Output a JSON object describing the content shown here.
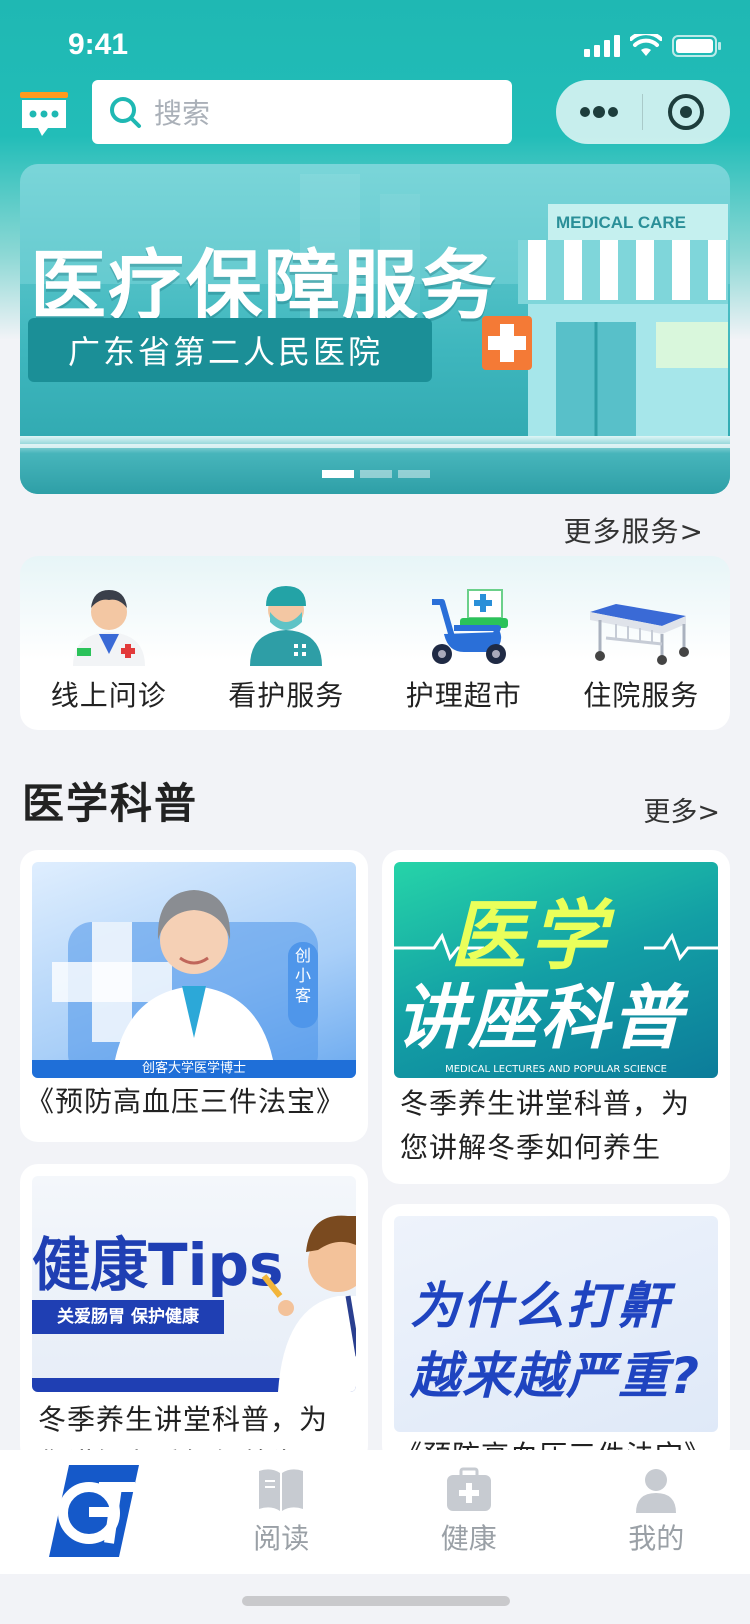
{
  "status": {
    "time": "9:41"
  },
  "header": {
    "search_placeholder": "搜索"
  },
  "banner": {
    "title": "医疗保障服务",
    "subtitle": "广东省第二人民医院",
    "store_sign": "MEDICAL CARE",
    "dots": 3,
    "active_dot": 0
  },
  "services": {
    "more_label": "更多服务>",
    "items": [
      {
        "label": "线上问诊",
        "icon": "doctor-icon"
      },
      {
        "label": "看护服务",
        "icon": "nurse-icon"
      },
      {
        "label": "护理超市",
        "icon": "delivery-scooter-icon"
      },
      {
        "label": "住院服务",
        "icon": "hospital-bed-icon"
      }
    ]
  },
  "science": {
    "title": "医学科普",
    "more_label": "更多>",
    "cards": [
      {
        "caption": "《预防高血压三件法宝》",
        "img_badge": "创小客",
        "img_footer": "创客大学医学博士"
      },
      {
        "caption": "冬季养生讲堂科普，为您讲解冬季如何养生",
        "img_line1": "医学",
        "img_line2": "讲座科普",
        "img_footer": "MEDICAL LECTURES AND POPULAR SCIENCE"
      },
      {
        "caption": "冬季养生讲堂科普，为您讲解冬季如何养生",
        "img_title": "健康Tips",
        "img_tag": "关爱肠胃 保护健康"
      },
      {
        "caption": "《预防高血压三件法宝》",
        "img_line1": "为什么打鼾",
        "img_line2": "越来越严重?"
      }
    ]
  },
  "tabbar": {
    "items": [
      {
        "label": "",
        "icon": "brand-logo"
      },
      {
        "label": "阅读",
        "icon": "book-icon"
      },
      {
        "label": "健康",
        "icon": "medical-kit-icon"
      },
      {
        "label": "我的",
        "icon": "user-icon"
      }
    ]
  },
  "colors": {
    "primary": "#1fb8b3",
    "banner_dark": "#1b8f97",
    "logo_blue": "#1559c9"
  }
}
